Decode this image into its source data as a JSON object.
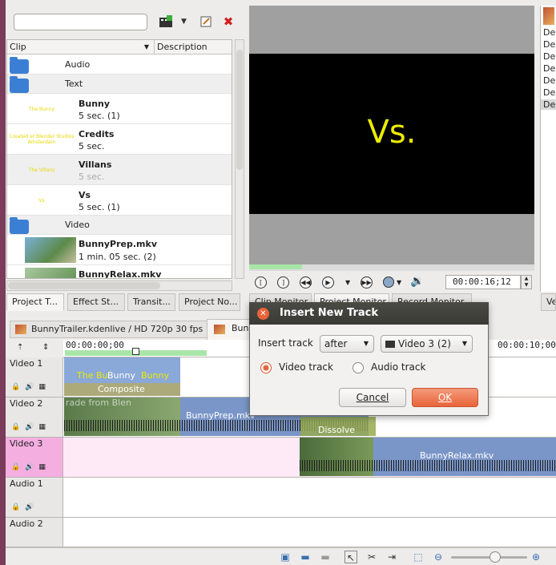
{
  "project_bin": {
    "search_value": "",
    "columns": [
      "Clip",
      "Description"
    ],
    "rows": [
      {
        "kind": "folder",
        "name": "Audio"
      },
      {
        "kind": "folder",
        "name": "Text"
      },
      {
        "kind": "clip",
        "name": "Bunny",
        "sub": "5 sec. (1)",
        "thumb": "The Bunny"
      },
      {
        "kind": "clip",
        "name": "Credits",
        "sub": "5 sec.",
        "thumb": "Created at Blender Studios Amsterdam"
      },
      {
        "kind": "clip",
        "name": "Villans",
        "sub": "5 sec.",
        "thumb": "The Villans"
      },
      {
        "kind": "clip",
        "name": "Vs",
        "sub": "5 sec. (1)",
        "thumb": "Vs"
      },
      {
        "kind": "folder",
        "name": "Video"
      },
      {
        "kind": "clip",
        "name": "BunnyPrep.mkv",
        "sub": "1 min. 05 sec. (2)"
      },
      {
        "kind": "clip",
        "name": "BunnyRelax.mkv",
        "sub": ""
      }
    ]
  },
  "left_tabs": [
    "Project T...",
    "Effect St...",
    "Transit...",
    "Project No..."
  ],
  "monitor": {
    "title_text": "Vs.",
    "timecode": "00:00:16;12",
    "tabs": [
      "Clip Monitor",
      "Project Monitor",
      "Record Monitor"
    ]
  },
  "right_panel": {
    "items": [
      "Del",
      "Del",
      "Del",
      "Del",
      "Del",
      "Del",
      "Del"
    ],
    "tab": "Ve"
  },
  "timeline": {
    "file_tab": "BunnyTrailer.kdenlive / HD 720p 30 fps",
    "file_tab2": "Bun",
    "ruler_start": "00:00:00;00",
    "ruler_end": "00:00:10;00",
    "tracks": [
      {
        "name": "Video 1"
      },
      {
        "name": "Video 2"
      },
      {
        "name": "Video 3"
      },
      {
        "name": "Audio 1"
      },
      {
        "name": "Audio 2"
      }
    ],
    "clips": {
      "bunny_title": "Bunny",
      "bunny_bg": "The Bu",
      "bunny_bg2": "Bunny",
      "composite": "Composite",
      "prep_label": "BunnyPrep.mkv",
      "dissolve": "Dissolve",
      "relax_label": "BunnyRelax.mkv",
      "prep_overlay": "rade from Blen"
    }
  },
  "dialog": {
    "title": "Insert New Track",
    "insert_label": "Insert track",
    "position_value": "after",
    "track_value": "Video 3 (2)",
    "video_radio": "Video track",
    "audio_radio": "Audio track",
    "cancel": "Cancel",
    "ok": "OK"
  }
}
